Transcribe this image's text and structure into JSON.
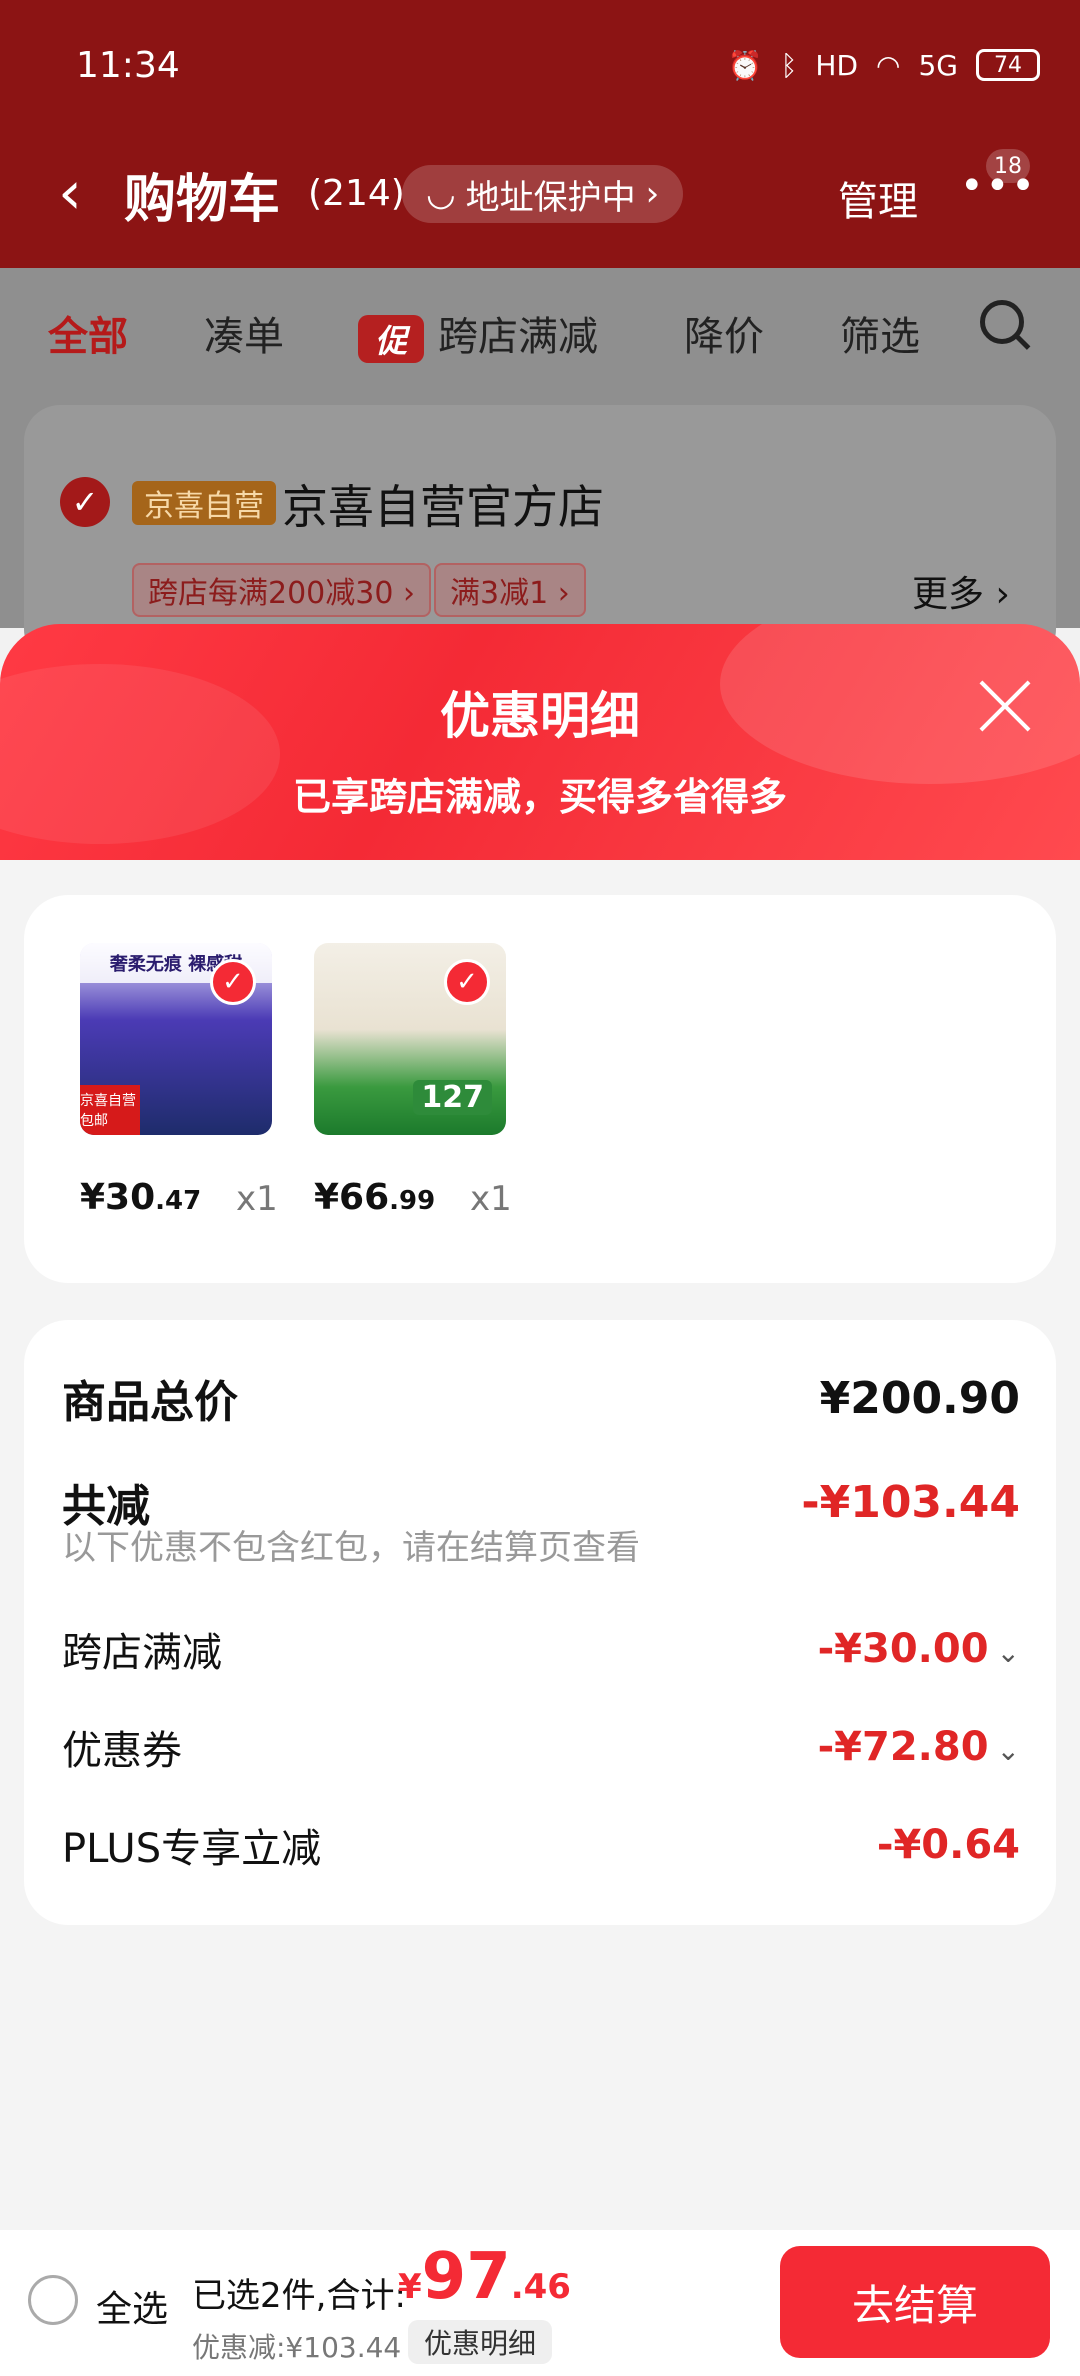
{
  "statusbar": {
    "time": "11:34",
    "battery": "74",
    "signal": "5G",
    "hd": "HD"
  },
  "header": {
    "title": "购物车",
    "count": "(214)",
    "address_protect": "地址保护中",
    "manage": "管理",
    "message_badge": "18"
  },
  "tabs": {
    "all": "全部",
    "bundle": "凑单",
    "promo_tag": "促",
    "cross_store": "跨店满减",
    "price_drop": "降价",
    "filter": "筛选"
  },
  "store": {
    "badge": "京喜自营",
    "name": "京喜自营官方店",
    "promos": [
      "跨店每满200减30 ›",
      "满3减1 ›"
    ],
    "more": "更多 ›"
  },
  "sheet": {
    "title": "优惠明细",
    "subtitle": "已享跨店满减，买得多省得多"
  },
  "products": [
    {
      "price_int": "¥30",
      "price_dec": ".47",
      "qty": "x1",
      "banner": "奢柔无痕 裸感甜",
      "corner": "京喜自营 包邮"
    },
    {
      "price_int": "¥66",
      "price_dec": ".99",
      "qty": "x1",
      "banner": "",
      "badge_price": "127"
    }
  ],
  "summary": {
    "total_label": "商品总价",
    "total_value": "¥200.90",
    "discount_label": "共减",
    "discount_value": "-¥103.44",
    "note": "以下优惠不包含红包，请在结算页查看",
    "items": [
      {
        "label": "跨店满减",
        "value": "-¥30.00"
      },
      {
        "label": "优惠券",
        "value": "-¥72.80"
      },
      {
        "label": "PLUS专享立减",
        "value": "-¥0.64"
      }
    ]
  },
  "bottom": {
    "select_all": "全选",
    "selected_text": "已选2件,合计:",
    "yen": "¥",
    "total_int": "97",
    "total_dec": ".46",
    "saved": "优惠减:¥103.44",
    "detail": "优惠明细",
    "checkout": "去结算"
  },
  "colors": {
    "brand_red": "#f42a35",
    "header_dark": "#8c1414",
    "discount_red": "#e02626"
  }
}
